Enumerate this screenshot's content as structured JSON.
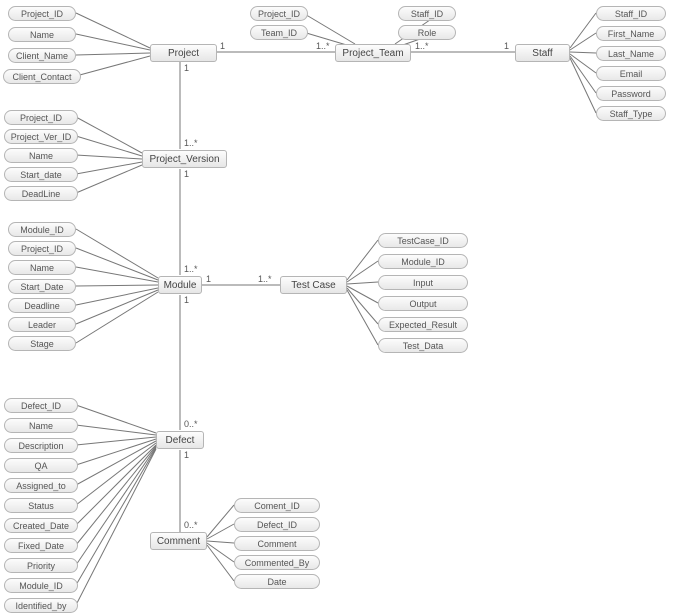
{
  "entities": {
    "project": "Project",
    "project_team": "Project_Team",
    "staff": "Staff",
    "project_version": "Project_Version",
    "module": "Module",
    "test_case": "Test Case",
    "defect": "Defect",
    "comment": "Comment"
  },
  "attrs": {
    "project": [
      "Project_ID",
      "Name",
      "Client_Name",
      "Client_Contact"
    ],
    "project_team": [
      "Project_ID",
      "Team_ID",
      "Staff_ID",
      "Role"
    ],
    "staff": [
      "Staff_ID",
      "First_Name",
      "Last_Name",
      "Email",
      "Password",
      "Staff_Type"
    ],
    "project_version": [
      "Project_ID",
      "Project_Ver_ID",
      "Name",
      "Start_date",
      "DeadLine"
    ],
    "module": [
      "Module_ID",
      "Project_ID",
      "Name",
      "Start_Date",
      "Deadline",
      "Leader",
      "Stage"
    ],
    "test_case": [
      "TestCase_ID",
      "Module_ID",
      "Input",
      "Output",
      "Expected_Result",
      "Test_Data"
    ],
    "defect": [
      "Defect_ID",
      "Name",
      "Description",
      "QA",
      "Assigned_to",
      "Status",
      "Created_Date",
      "Fixed_Date",
      "Priority",
      "Module_ID",
      "Identified_by"
    ],
    "comment": [
      "Coment_ID",
      "Defect_ID",
      "Comment",
      "Commented_By",
      "Date"
    ]
  },
  "cards": {
    "project_to_team_left": "1",
    "project_to_team_right": "1..*",
    "team_to_staff_left": "1..*",
    "team_to_staff_right": "1",
    "project_below": "1",
    "pv_top": "1..*",
    "pv_below": "1",
    "module_top": "1..*",
    "module_right1": "1",
    "testcase_left": "1..*",
    "module_below": "1",
    "defect_top": "0..*",
    "defect_below": "1",
    "comment_top": "0..*"
  }
}
